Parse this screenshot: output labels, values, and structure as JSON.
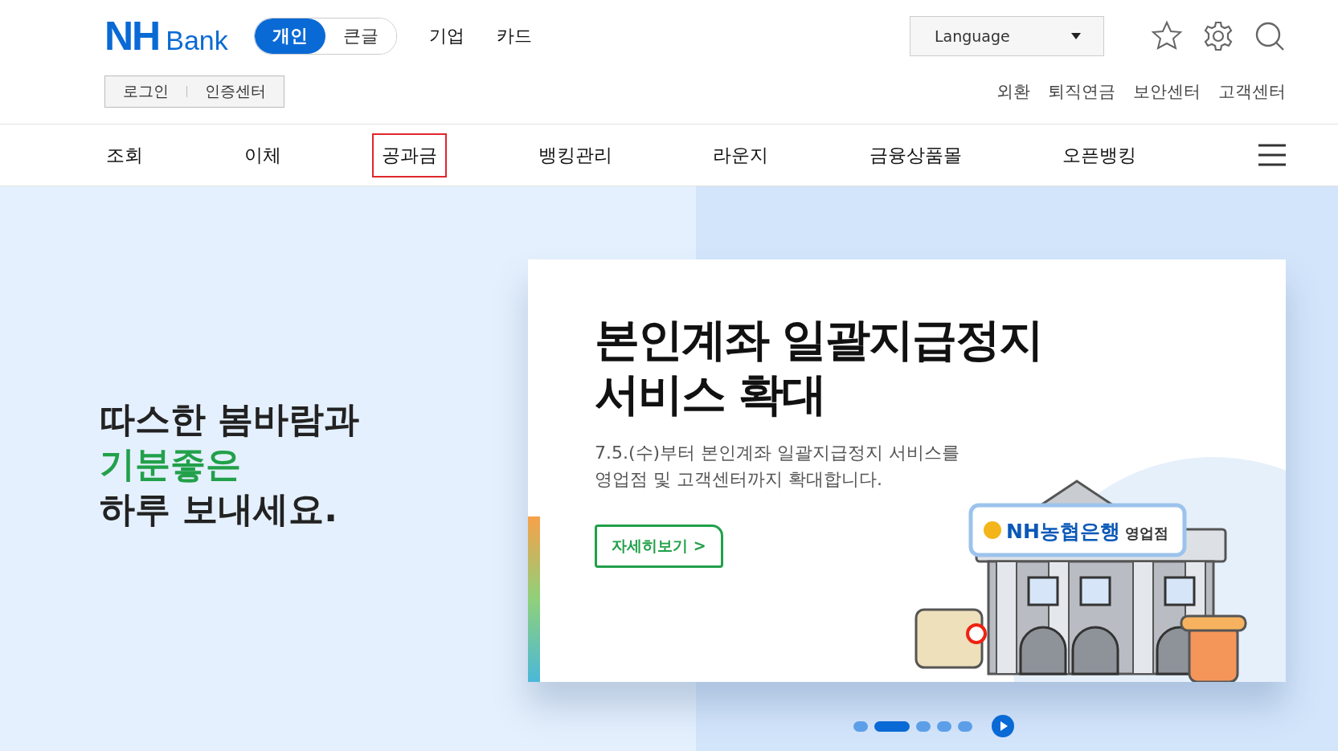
{
  "header": {
    "logo": {
      "mark": "NH",
      "word": "Bank"
    },
    "modes": [
      {
        "label": "개인",
        "selected": true
      },
      {
        "label": "큰글",
        "selected": false
      }
    ],
    "top_links": [
      "기업",
      "카드"
    ],
    "language": {
      "value": "Language"
    },
    "account_links": [
      "로그인",
      "인증센터"
    ],
    "utility_links": [
      "외환",
      "퇴직연금",
      "보안센터",
      "고객센터"
    ]
  },
  "nav": {
    "items": [
      {
        "label": "조회",
        "selected": false
      },
      {
        "label": "이체",
        "selected": false
      },
      {
        "label": "공과금",
        "selected": true
      },
      {
        "label": "뱅킹관리",
        "selected": false
      },
      {
        "label": "라운지",
        "selected": false
      },
      {
        "label": "금융상품몰",
        "selected": false
      },
      {
        "label": "오픈뱅킹",
        "selected": false
      }
    ]
  },
  "hero": {
    "greeting": [
      "따스한 봄바람과",
      "기분좋은",
      "하루 보내세요."
    ],
    "banner": {
      "title": [
        "본인계좌 일괄지급정지",
        "서비스 확대"
      ],
      "body": [
        "7.5.(수)부터 본인계좌 일괄지급정지 서비스를",
        "영업점 및 고객센터까지 확대합니다."
      ],
      "button": "자세히보기 >",
      "sign": {
        "brand": "NH농협은행",
        "suffix": "영업점"
      }
    },
    "dots": [
      {
        "selected": false
      },
      {
        "selected": true
      },
      {
        "selected": false
      },
      {
        "selected": false
      },
      {
        "selected": false
      }
    ]
  }
}
